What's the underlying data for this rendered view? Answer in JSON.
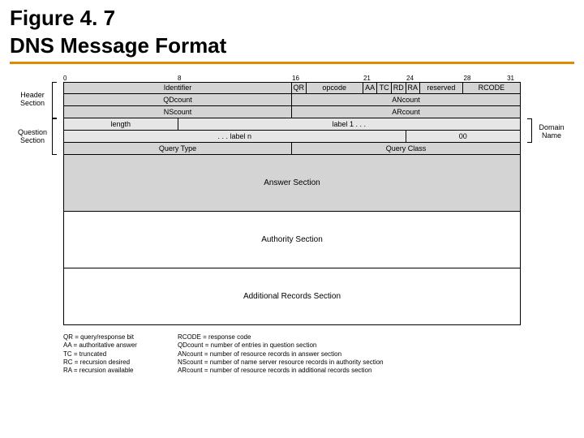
{
  "title_line1": "Figure 4. 7",
  "title_line2": "DNS Message Format",
  "ticks": {
    "t0": "0",
    "t8": "8",
    "t16": "16",
    "t21": "21",
    "t24": "24",
    "t28": "28",
    "t31": "31"
  },
  "side": {
    "header": "Header\nSection",
    "question": "Question\nSection",
    "domain": "Domain\nName"
  },
  "row0": {
    "identifier": "Identifier",
    "qr": "QR",
    "opcode": "opcode",
    "aa": "AA",
    "tc": "TC",
    "rd": "RD",
    "ra": "RA",
    "reserved": "reserved",
    "rcode": "RCODE"
  },
  "row1": {
    "qd": "QDcount",
    "an": "ANcount"
  },
  "row2": {
    "ns": "NScount",
    "ar": "ARcount"
  },
  "row3": {
    "length": "length",
    "label1": "label 1 . . ."
  },
  "row4": {
    "labeln": ". . . label n",
    "zero": "00"
  },
  "row5": {
    "qtype": "Query Type",
    "qclass": "Query Class"
  },
  "sections": {
    "answer": "Answer Section",
    "authority": "Authority Section",
    "additional": "Additional Records Section"
  },
  "legend": {
    "col1": {
      "l1": "QR = query/response bit",
      "l2": "AA = authoritative answer",
      "l3": "TC = truncated",
      "l4": "RC = recursion desired",
      "l5": "RA = recursion available"
    },
    "col2": {
      "l1": "RCODE = response code",
      "l2": "QDcount = number of entries in question section",
      "l3": "ANcount = number of resource records in answer section",
      "l4": "NScount = number of name server resource records in authority section",
      "l5": "ARcount = number of resource records in additional records section"
    }
  },
  "chart_data": {
    "type": "table",
    "title": "DNS Message Format",
    "bit_positions": [
      0,
      8,
      16,
      21,
      24,
      28,
      31
    ],
    "header_section": {
      "word0": [
        {
          "name": "Identifier",
          "bits": "0-15"
        },
        {
          "name": "QR",
          "bits": "16"
        },
        {
          "name": "opcode",
          "bits": "17-20"
        },
        {
          "name": "AA",
          "bits": "21"
        },
        {
          "name": "TC",
          "bits": "22"
        },
        {
          "name": "RD",
          "bits": "23"
        },
        {
          "name": "RA",
          "bits": "24"
        },
        {
          "name": "reserved",
          "bits": "25-27"
        },
        {
          "name": "RCODE",
          "bits": "28-31"
        }
      ],
      "word1": [
        {
          "name": "QDcount",
          "bits": "0-15"
        },
        {
          "name": "ANcount",
          "bits": "16-31"
        }
      ],
      "word2": [
        {
          "name": "NScount",
          "bits": "0-15"
        },
        {
          "name": "ARcount",
          "bits": "16-31"
        }
      ]
    },
    "question_section": {
      "domain_name": [
        {
          "name": "length",
          "bits": "0-7"
        },
        {
          "name": "label 1 . . ."
        },
        {
          "name": ". . . label n"
        },
        {
          "name": "00"
        }
      ],
      "trailer": [
        {
          "name": "Query Type",
          "bits": "0-15"
        },
        {
          "name": "Query Class",
          "bits": "16-31"
        }
      ]
    },
    "remaining_sections": [
      "Answer Section",
      "Authority Section",
      "Additional Records Section"
    ],
    "legend": {
      "QR": "query/response bit",
      "AA": "authoritative answer",
      "TC": "truncated",
      "RC": "recursion desired",
      "RA": "recursion available",
      "RCODE": "response code",
      "QDcount": "number of entries in question section",
      "ANcount": "number of resource records in answer section",
      "NScount": "number of name server resource records in authority section",
      "ARcount": "number of resource records in additional records section"
    }
  }
}
